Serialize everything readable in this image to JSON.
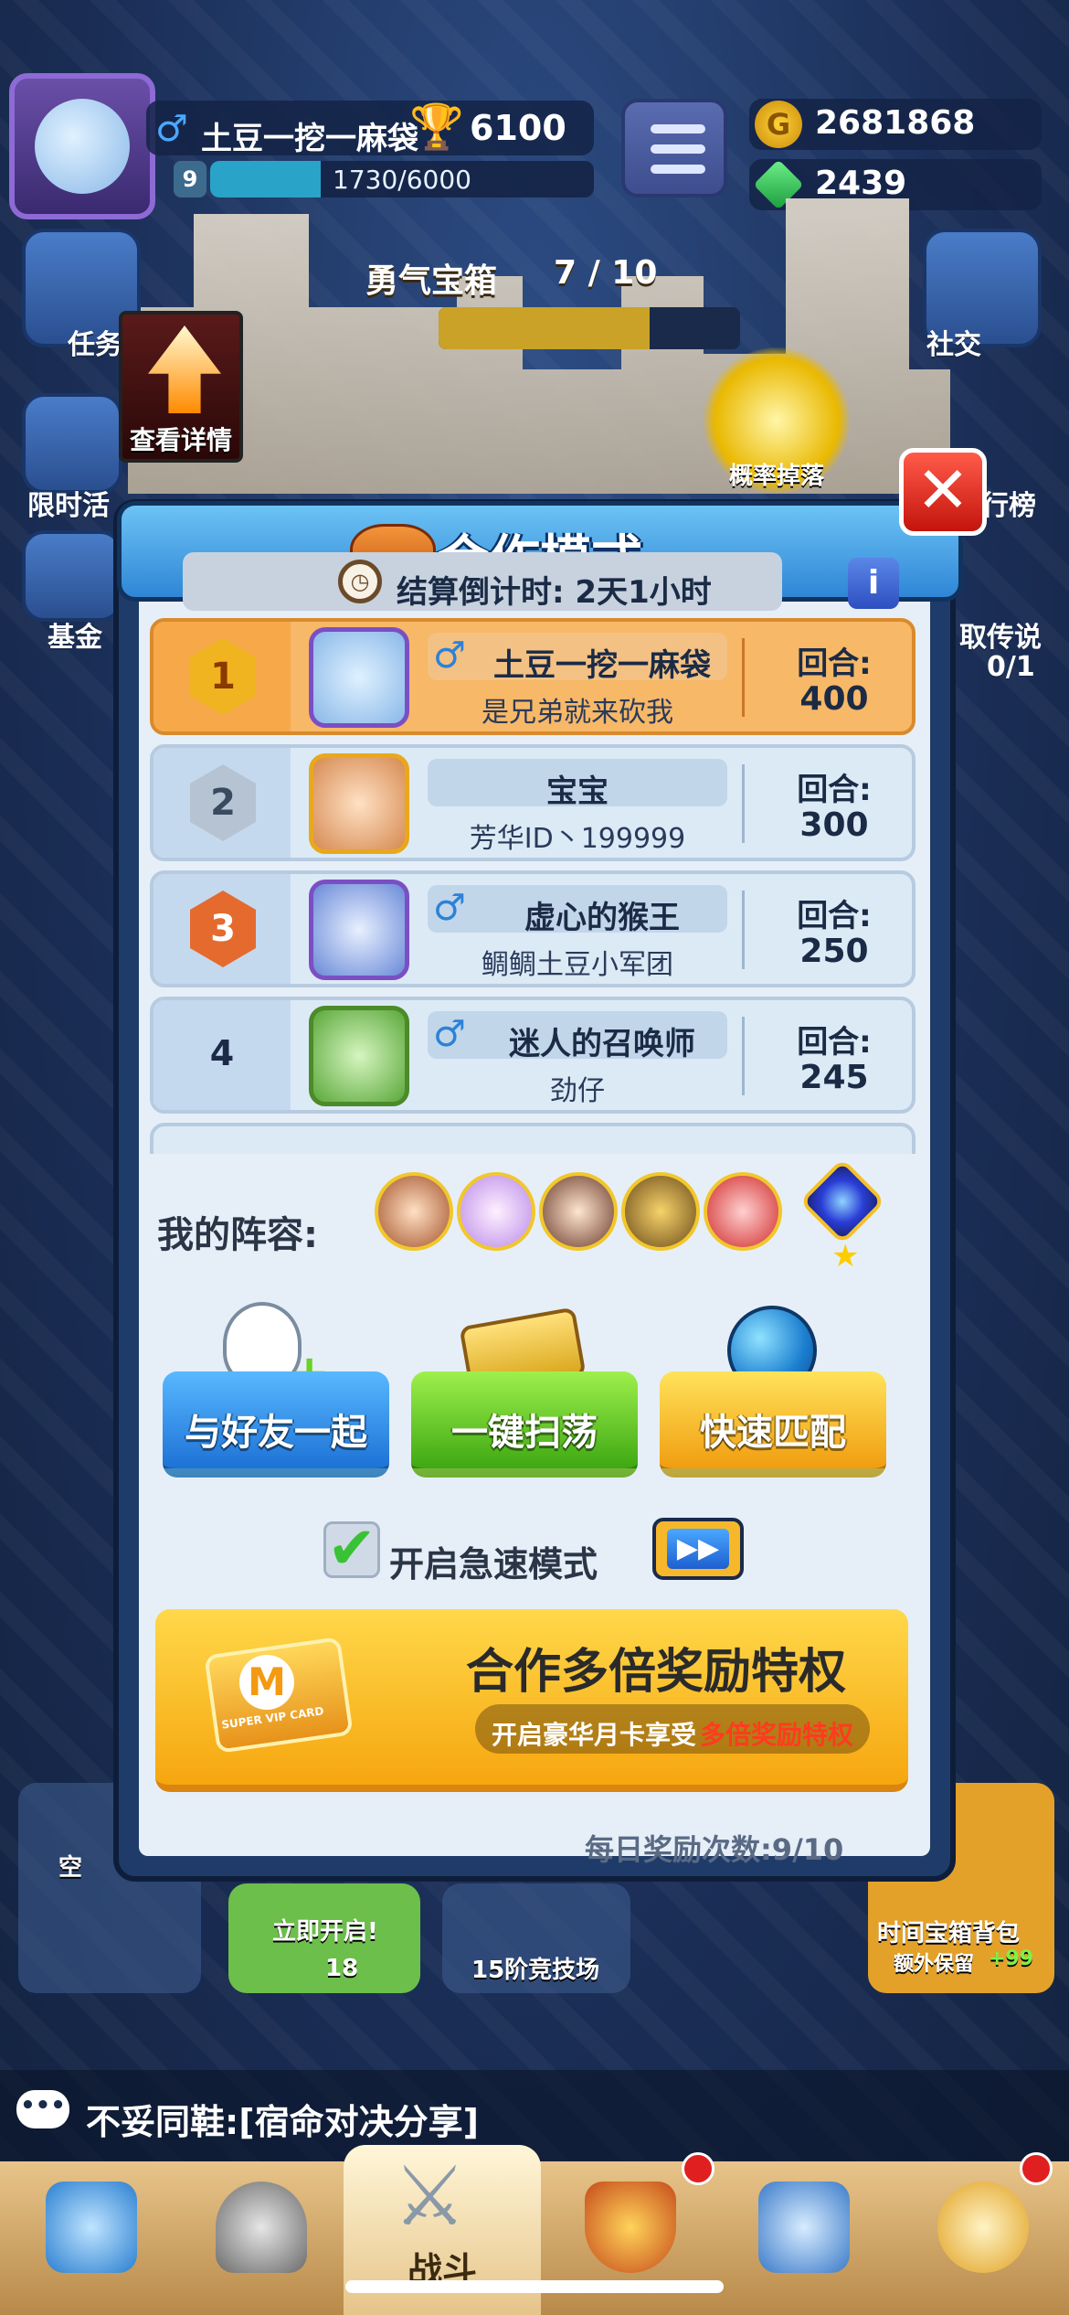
{
  "player": {
    "name": "土豆一挖一麻袋",
    "level": "9",
    "trophies": "6100",
    "xp_text": "1730/6000",
    "xp_fraction": 0.288
  },
  "currency": {
    "coins": "2681868",
    "gems": "2439"
  },
  "background": {
    "chest_title": "勇气宝箱",
    "chest_count": "7 / 10",
    "chest_fraction": 0.7,
    "side_left_1": "任务",
    "side_left_2": "限时活",
    "side_left_3": "基金",
    "side_right_1": "社交",
    "side_right_2": "行榜",
    "side_right_3": "取传说",
    "side_right_3_count": "0/1",
    "detail_label": "查看详情",
    "drop_label": "概率掉落"
  },
  "modal": {
    "title": "合作模式",
    "close_glyph": "✕",
    "countdown": "结算倒计时:  2天1小时",
    "info_glyph": "i",
    "clock_glyph": "◷"
  },
  "rank_list": [
    {
      "rank": "1",
      "gender": "♂",
      "name": "土豆一挖一麻袋",
      "guild": "是兄弟就来砍我",
      "round_label": "回合:",
      "rounds": "400"
    },
    {
      "rank": "2",
      "gender": "",
      "name": "宝宝",
      "guild": "芳华ID丶199999",
      "round_label": "回合:",
      "rounds": "300"
    },
    {
      "rank": "3",
      "gender": "♂",
      "name": "虚心的猴王",
      "guild": "鲷鲷土豆小军团",
      "round_label": "回合:",
      "rounds": "250"
    },
    {
      "rank": "4",
      "gender": "♂",
      "name": "迷人的召唤师",
      "guild": "劲仔",
      "round_label": "回合:",
      "rounds": "245"
    }
  ],
  "lineup": {
    "label": "我的阵容:"
  },
  "actions": {
    "with_friend": "与好友一起",
    "sweep": "一键扫荡",
    "quick_match": "快速匹配"
  },
  "speed_mode": {
    "label": "开启急速模式",
    "checked_glyph": "✔",
    "ff_glyph": "▶▶"
  },
  "banner": {
    "title": "合作多倍奖励特权",
    "sub": "开启豪华月卡享受",
    "sub_highlight": "多倍奖励特权",
    "card_letter": "M",
    "card_text": "SUPER VIP CARD"
  },
  "daily": {
    "text": "每日奖励次数:9/10"
  },
  "below_modal": {
    "card1": "立即开启!",
    "card1_gems": "18",
    "card2": "15阶竞技场",
    "card3": "时间宝箱背包",
    "card3_sub": "额外保留",
    "card3_bonus": "+99",
    "card_left": "空"
  },
  "chat": {
    "icon_glyph": "•••",
    "text": "不妥同鞋:[宿命对决分享]"
  },
  "tabbar": {
    "active_label": "战斗"
  },
  "colors": {
    "accent_blue": "#2f86d6",
    "accent_orange": "#f7b867",
    "highlight_red": "#ff3b1f"
  }
}
